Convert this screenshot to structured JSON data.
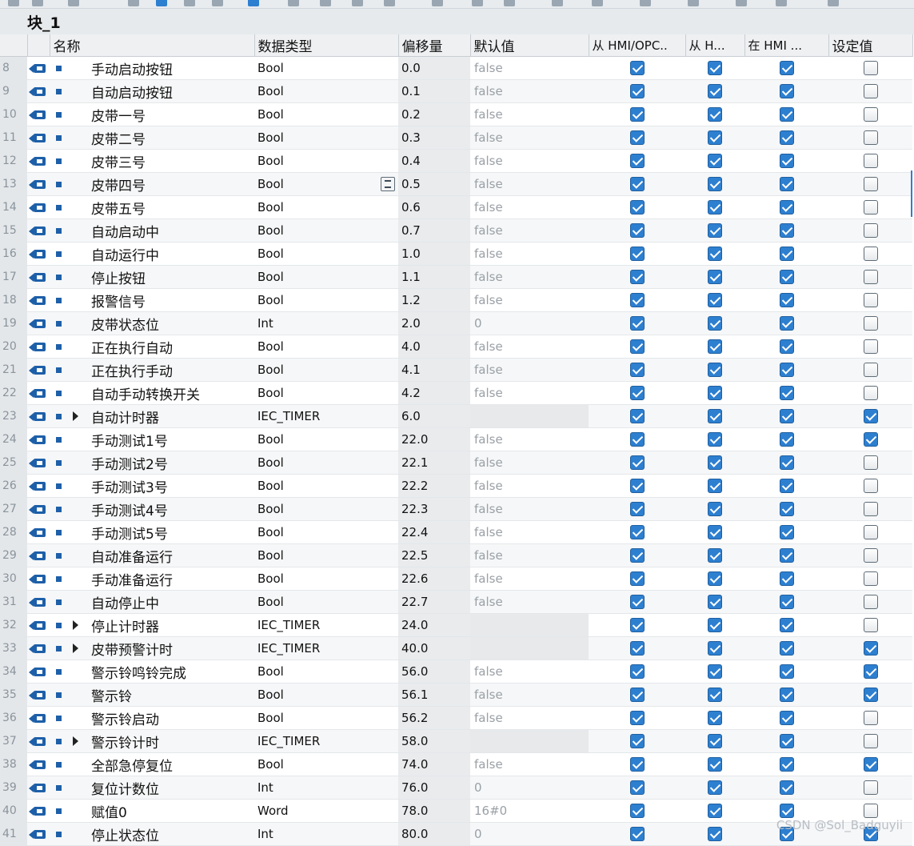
{
  "block": {
    "title": "块_1"
  },
  "headers": {
    "name": "名称",
    "datatype": "数据类型",
    "offset": "偏移量",
    "default": "默认值",
    "hmi_access": "从 HMI/OPC..",
    "hmi_write": "从 H...",
    "hmi_visible": "在 HMI ...",
    "setpoint": "设定值"
  },
  "rows": [
    {
      "n": "8",
      "name": "手动启动按钮",
      "type": "Bool",
      "offset": "0.0",
      "default": "false",
      "expand": false,
      "sp": false
    },
    {
      "n": "9",
      "name": "自动启动按钮",
      "type": "Bool",
      "offset": "0.1",
      "default": "false",
      "expand": false,
      "sp": false
    },
    {
      "n": "10",
      "name": "皮带一号",
      "type": "Bool",
      "offset": "0.2",
      "default": "false",
      "expand": false,
      "sp": false
    },
    {
      "n": "11",
      "name": "皮带二号",
      "type": "Bool",
      "offset": "0.3",
      "default": "false",
      "expand": false,
      "sp": false
    },
    {
      "n": "12",
      "name": "皮带三号",
      "type": "Bool",
      "offset": "0.4",
      "default": "false",
      "expand": false,
      "sp": false
    },
    {
      "n": "13",
      "name": "皮带四号",
      "type": "Bool",
      "offset": "0.5",
      "default": "false",
      "expand": false,
      "sp": false,
      "btn": true
    },
    {
      "n": "14",
      "name": "皮带五号",
      "type": "Bool",
      "offset": "0.6",
      "default": "false",
      "expand": false,
      "sp": false
    },
    {
      "n": "15",
      "name": "自动启动中",
      "type": "Bool",
      "offset": "0.7",
      "default": "false",
      "expand": false,
      "sp": false
    },
    {
      "n": "16",
      "name": "自动运行中",
      "type": "Bool",
      "offset": "1.0",
      "default": "false",
      "expand": false,
      "sp": false
    },
    {
      "n": "17",
      "name": "停止按钮",
      "type": "Bool",
      "offset": "1.1",
      "default": "false",
      "expand": false,
      "sp": false
    },
    {
      "n": "18",
      "name": "报警信号",
      "type": "Bool",
      "offset": "1.2",
      "default": "false",
      "expand": false,
      "sp": false
    },
    {
      "n": "19",
      "name": "皮带状态位",
      "type": "Int",
      "offset": "2.0",
      "default": "0",
      "expand": false,
      "sp": false
    },
    {
      "n": "20",
      "name": "正在执行自动",
      "type": "Bool",
      "offset": "4.0",
      "default": "false",
      "expand": false,
      "sp": false
    },
    {
      "n": "21",
      "name": "正在执行手动",
      "type": "Bool",
      "offset": "4.1",
      "default": "false",
      "expand": false,
      "sp": false
    },
    {
      "n": "22",
      "name": "自动手动转换开关",
      "type": "Bool",
      "offset": "4.2",
      "default": "false",
      "expand": false,
      "sp": false
    },
    {
      "n": "23",
      "name": "自动计时器",
      "type": "IEC_TIMER",
      "offset": "6.0",
      "default": "",
      "expand": true,
      "sp": true
    },
    {
      "n": "24",
      "name": "手动测试1号",
      "type": "Bool",
      "offset": "22.0",
      "default": "false",
      "expand": false,
      "sp": true
    },
    {
      "n": "25",
      "name": "手动测试2号",
      "type": "Bool",
      "offset": "22.1",
      "default": "false",
      "expand": false,
      "sp": false
    },
    {
      "n": "26",
      "name": "手动测试3号",
      "type": "Bool",
      "offset": "22.2",
      "default": "false",
      "expand": false,
      "sp": false
    },
    {
      "n": "27",
      "name": "手动测试4号",
      "type": "Bool",
      "offset": "22.3",
      "default": "false",
      "expand": false,
      "sp": false
    },
    {
      "n": "28",
      "name": "手动测试5号",
      "type": "Bool",
      "offset": "22.4",
      "default": "false",
      "expand": false,
      "sp": false
    },
    {
      "n": "29",
      "name": "自动准备运行",
      "type": "Bool",
      "offset": "22.5",
      "default": "false",
      "expand": false,
      "sp": false
    },
    {
      "n": "30",
      "name": "手动准备运行",
      "type": "Bool",
      "offset": "22.6",
      "default": "false",
      "expand": false,
      "sp": false
    },
    {
      "n": "31",
      "name": "自动停止中",
      "type": "Bool",
      "offset": "22.7",
      "default": "false",
      "expand": false,
      "sp": false
    },
    {
      "n": "32",
      "name": "停止计时器",
      "type": "IEC_TIMER",
      "offset": "24.0",
      "default": "",
      "expand": true,
      "sp": false
    },
    {
      "n": "33",
      "name": "皮带预警计时",
      "type": "IEC_TIMER",
      "offset": "40.0",
      "default": "",
      "expand": true,
      "sp": true
    },
    {
      "n": "34",
      "name": "警示铃鸣铃完成",
      "type": "Bool",
      "offset": "56.0",
      "default": "false",
      "expand": false,
      "sp": true
    },
    {
      "n": "35",
      "name": "警示铃",
      "type": "Bool",
      "offset": "56.1",
      "default": "false",
      "expand": false,
      "sp": true
    },
    {
      "n": "36",
      "name": "警示铃启动",
      "type": "Bool",
      "offset": "56.2",
      "default": "false",
      "expand": false,
      "sp": false
    },
    {
      "n": "37",
      "name": "警示铃计时",
      "type": "IEC_TIMER",
      "offset": "58.0",
      "default": "",
      "expand": true,
      "sp": false
    },
    {
      "n": "38",
      "name": "全部急停复位",
      "type": "Bool",
      "offset": "74.0",
      "default": "false",
      "expand": false,
      "sp": true
    },
    {
      "n": "39",
      "name": "复位计数位",
      "type": "Int",
      "offset": "76.0",
      "default": "0",
      "expand": false,
      "sp": false
    },
    {
      "n": "40",
      "name": "赋值0",
      "type": "Word",
      "offset": "78.0",
      "default": "16#0",
      "expand": false,
      "sp": false
    },
    {
      "n": "41",
      "name": "停止状态位",
      "type": "Int",
      "offset": "80.0",
      "default": "0",
      "expand": false,
      "sp": true
    }
  ],
  "watermark": "CSDN @Sol_Badguyii",
  "colors": {
    "accent": "#2d7fd0",
    "icon": "#1d5fa8"
  }
}
